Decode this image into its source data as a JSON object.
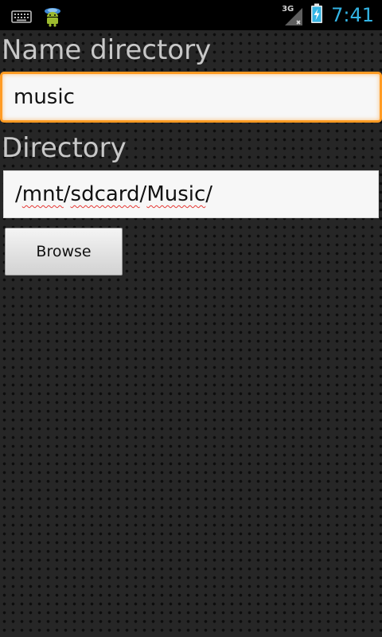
{
  "status_bar": {
    "network_type": "3G",
    "time": "7:41",
    "icons": [
      "keyboard-icon",
      "android-notification-icon",
      "signal-icon",
      "battery-charging-icon"
    ]
  },
  "form": {
    "name_label": "Name directory",
    "name_value": "music",
    "dir_label": "Directory",
    "dir_parts": [
      "/",
      "mnt",
      "/",
      "sdcard",
      "/",
      "Music",
      "/"
    ],
    "browse_label": "Browse"
  },
  "colors": {
    "focus_border": "#ff9b24",
    "clock": "#33b5e5"
  }
}
